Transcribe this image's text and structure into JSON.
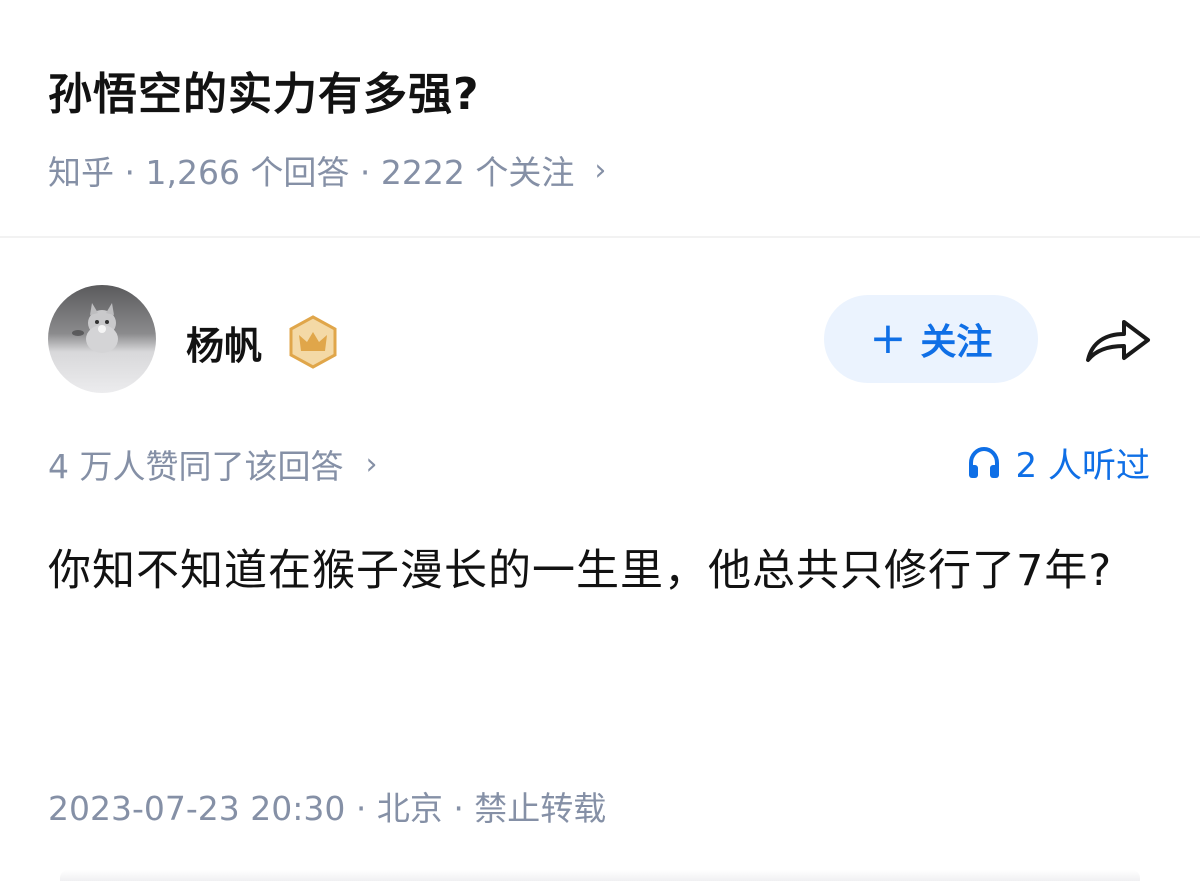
{
  "question": {
    "title": "孙悟空的实力有多强?",
    "meta": "知乎 · 1,266 个回答 · 2222 个关注",
    "chevron": "›"
  },
  "author": {
    "name": "杨帆",
    "badge": "crown-badge-icon"
  },
  "follow": {
    "plus": "+",
    "label": "关注"
  },
  "share": {
    "icon": "share-arrow-icon"
  },
  "votes": {
    "text": "4 万人赞同了该回答",
    "chevron": "›"
  },
  "listen": {
    "text": "2 人听过",
    "icon": "headphones-icon"
  },
  "answer": {
    "body": "你知不知道在猴子漫长的一生里，他总共只修行了7年?"
  },
  "footer": {
    "text": "2023-07-23 20:30 · 北京 · 禁止转载"
  },
  "colors": {
    "accent": "#0f6fe6",
    "muted": "#8590a6",
    "follow_bg": "#ebf3fe",
    "badge": "#e0a64a"
  }
}
